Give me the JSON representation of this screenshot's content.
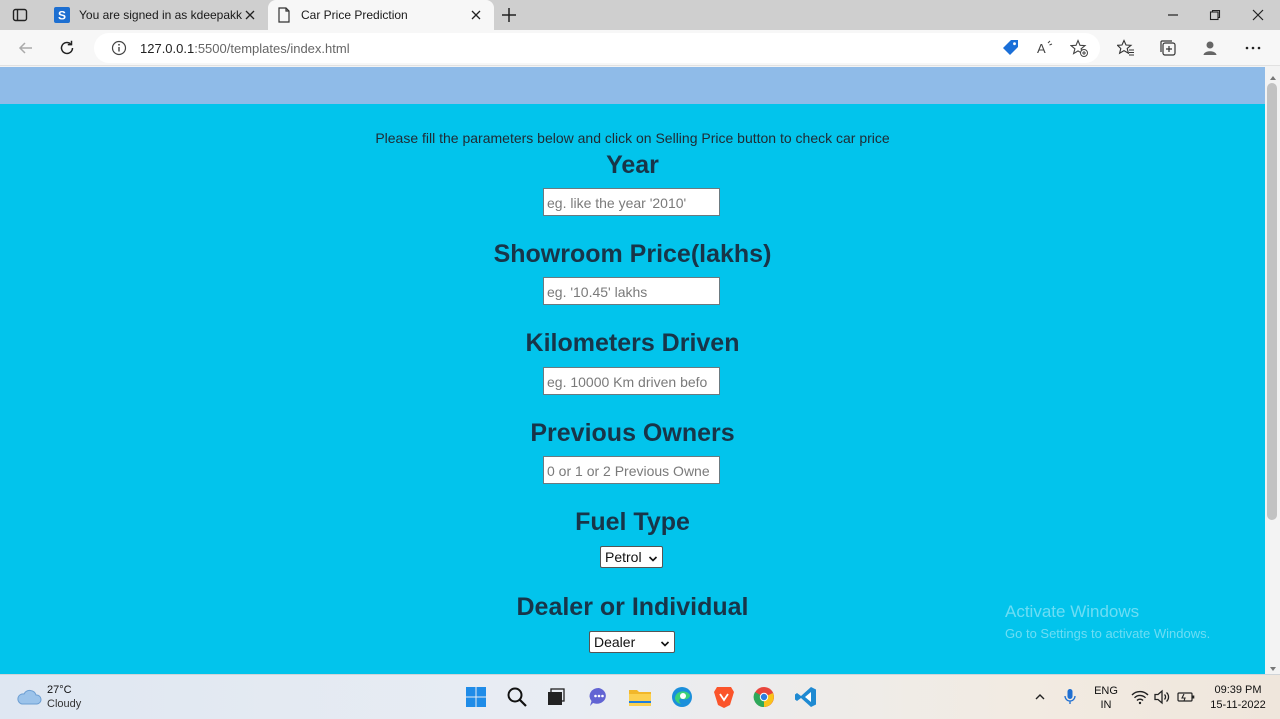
{
  "browser": {
    "tabs": [
      {
        "title": "You are signed in as kdeepakkun",
        "favicon": "s-logo-icon",
        "active": false
      },
      {
        "title": "Car Price Prediction",
        "favicon": "page-icon",
        "active": true
      }
    ],
    "url_host": "127.0.0.1",
    "url_rest": ":5500/templates/index.html"
  },
  "page": {
    "intro": "Please fill the parameters below and click on Selling Price button to check car price",
    "year": {
      "label": "Year",
      "placeholder": "eg. like the year '2010'"
    },
    "price": {
      "label": "Showroom Price(lakhs)",
      "placeholder": "eg. '10.45' lakhs"
    },
    "km": {
      "label": "Kilometers Driven",
      "placeholder": "eg. 10000 Km driven befo"
    },
    "owners": {
      "label": "Previous Owners",
      "placeholder": "0 or 1 or 2 Previous Owne"
    },
    "fuel": {
      "label": "Fuel Type",
      "selected": "Petrol"
    },
    "seller": {
      "label": "Dealer or Individual",
      "selected": "Dealer"
    }
  },
  "watermark": {
    "line1": "Activate Windows",
    "line2": "Go to Settings to activate Windows."
  },
  "taskbar": {
    "temperature": "27°C",
    "condition": "Cloudy",
    "lang1": "ENG",
    "lang2": "IN",
    "time": "09:39 PM",
    "date": "15-11-2022"
  },
  "colors": {
    "page_bg": "#02c4ec",
    "band": "#8fbbe8",
    "heading": "#183549"
  }
}
